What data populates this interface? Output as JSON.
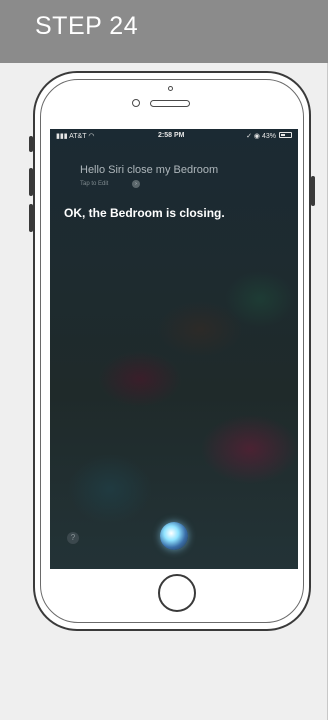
{
  "header": {
    "step_label": "STEP 24"
  },
  "status_bar": {
    "carrier": "AT&T",
    "time": "2:58 PM",
    "right_indicators": "✓ ◉ 43%",
    "battery_percent": 43
  },
  "siri": {
    "query": "Hello Siri close my Bedroom",
    "tap_to_edit": "Tap to Edit",
    "response": "OK, the Bedroom is closing."
  },
  "icons": {
    "help": "?",
    "tap_chevron": "›"
  },
  "colors": {
    "header_bg": "#8b8b8b",
    "page_bg": "#efefef",
    "response_text": "#ffffff"
  }
}
